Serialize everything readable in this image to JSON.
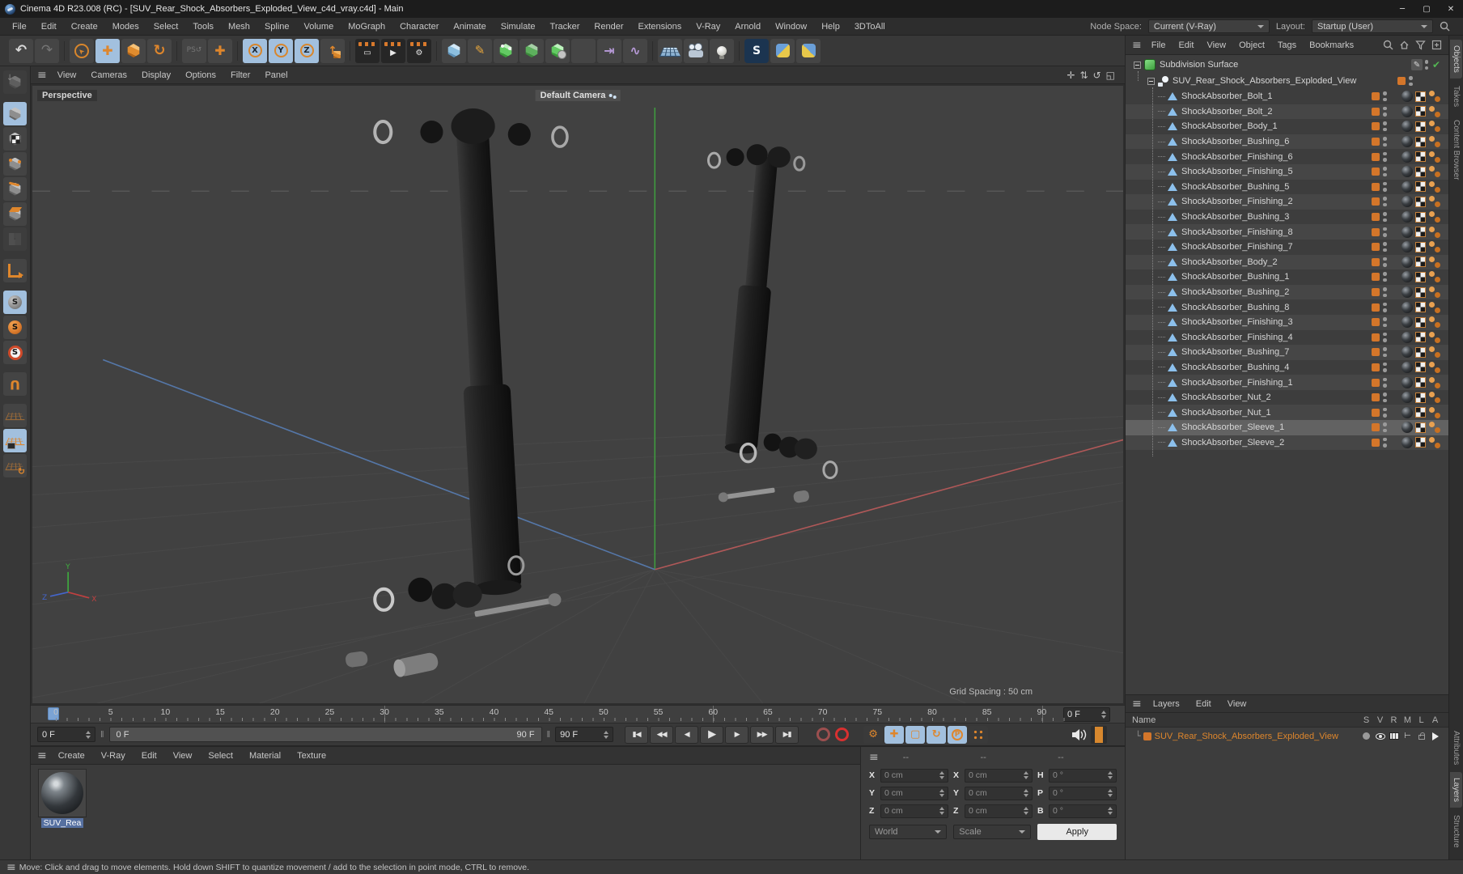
{
  "window": {
    "title": "Cinema 4D R23.008 (RC) - [SUV_Rear_Shock_Absorbers_Exploded_View_c4d_vray.c4d] - Main",
    "minimize": "─",
    "maximize": "▢",
    "close": "✕"
  },
  "menubar": {
    "items": [
      "File",
      "Edit",
      "Create",
      "Modes",
      "Select",
      "Tools",
      "Mesh",
      "Spline",
      "Volume",
      "MoGraph",
      "Character",
      "Animate",
      "Simulate",
      "Tracker",
      "Render",
      "Extensions",
      "V-Ray",
      "Arnold",
      "Window",
      "Help",
      "3DToAll"
    ],
    "node_space_label": "Node Space:",
    "node_space_value": "Current (V-Ray)",
    "layout_label": "Layout:",
    "layout_value": "Startup (User)"
  },
  "toolbar": {
    "tools": [
      {
        "name": "undo-button",
        "glyph": "↶",
        "cls": "t-undo"
      },
      {
        "name": "redo-button",
        "glyph": "↷",
        "cls": "t-dim"
      },
      {
        "name": "toolbar-separator",
        "glyph": "",
        "cls": "sep"
      },
      {
        "name": "live-selection-tool",
        "glyph": "➤",
        "cls": "t-sel-cursor"
      },
      {
        "name": "move-tool",
        "glyph": "✚",
        "cls": "t-orange active-blue"
      },
      {
        "name": "scale-tool",
        "glyph": "",
        "cls": "cube-orange"
      },
      {
        "name": "rotate-tool",
        "glyph": "↻",
        "cls": "t-orange t-big"
      },
      {
        "name": "toolbar-separator",
        "glyph": "",
        "cls": "sep"
      },
      {
        "name": "last-tool-psr",
        "glyph": "PS↺",
        "cls": "t-dim t-small"
      },
      {
        "name": "active-tool-move",
        "glyph": "✚",
        "cls": "t-orange"
      },
      {
        "name": "toolbar-separator",
        "glyph": "",
        "cls": "sep"
      },
      {
        "name": "lock-x-axis-button",
        "glyph": "X",
        "cls": "axis active-blue"
      },
      {
        "name": "lock-y-axis-button",
        "glyph": "Y",
        "cls": "axis active-blue"
      },
      {
        "name": "lock-z-axis-button",
        "glyph": "Z",
        "cls": "axis active-blue"
      },
      {
        "name": "coordinate-system-button",
        "glyph": "↑",
        "cls": "t-coord"
      },
      {
        "name": "toolbar-separator",
        "glyph": "",
        "cls": "sep"
      },
      {
        "name": "render-view-button",
        "glyph": "▭",
        "cls": "clapper"
      },
      {
        "name": "render-picture-viewer-button",
        "glyph": "▶",
        "cls": "clapper"
      },
      {
        "name": "render-settings-button",
        "glyph": "⚙",
        "cls": "clapper"
      },
      {
        "name": "toolbar-separator",
        "glyph": "",
        "cls": "sep"
      },
      {
        "name": "primitive-cube-button",
        "glyph": "",
        "cls": "cube-blue"
      },
      {
        "name": "spline-pen-button",
        "glyph": "✎",
        "cls": "t-pen"
      },
      {
        "name": "subdivision-surface-button",
        "glyph": "",
        "cls": "cube-green dots"
      },
      {
        "name": "generator-button",
        "glyph": "",
        "cls": "cube-green open"
      },
      {
        "name": "deformer-button",
        "glyph": "",
        "cls": "cube-green blob"
      },
      {
        "name": "volume-button",
        "glyph": "",
        "cls": "cubes-green"
      },
      {
        "name": "mograph-button",
        "glyph": "⇥",
        "cls": "t-purple"
      },
      {
        "name": "fields-button",
        "glyph": "∿",
        "cls": "t-purple"
      },
      {
        "name": "toolbar-separator",
        "glyph": "",
        "cls": "sep"
      },
      {
        "name": "floor-button",
        "glyph": "",
        "cls": "floor-grid"
      },
      {
        "name": "camera-button",
        "glyph": "",
        "cls": "cam"
      },
      {
        "name": "light-button",
        "glyph": "",
        "cls": "bulb"
      },
      {
        "name": "toolbar-separator",
        "glyph": "",
        "cls": "sep"
      },
      {
        "name": "vray-button",
        "glyph": "S",
        "cls": "vray"
      },
      {
        "name": "python-button",
        "glyph": "",
        "cls": "py"
      },
      {
        "name": "python-button-2",
        "glyph": "",
        "cls": "py py2"
      }
    ]
  },
  "left_toolbar": {
    "tools": [
      {
        "name": "make-editable-button",
        "glyph": "",
        "cls": "lc lc-dim arrow"
      },
      {
        "name": "left-separator",
        "glyph": "",
        "cls": "lsep"
      },
      {
        "name": "model-mode-button",
        "glyph": "",
        "cls": "lc active-blue"
      },
      {
        "name": "texture-mode-button",
        "glyph": "",
        "cls": "lc checker"
      },
      {
        "name": "point-mode-button",
        "glyph": "",
        "cls": "lc pts"
      },
      {
        "name": "edge-mode-button",
        "glyph": "",
        "cls": "lc edge"
      },
      {
        "name": "polygon-mode-button",
        "glyph": "",
        "cls": "lc face"
      },
      {
        "name": "uv-mode-button",
        "glyph": "",
        "cls": "flat lc-dim"
      },
      {
        "name": "left-separator",
        "glyph": "",
        "cls": "lsep"
      },
      {
        "name": "axis-mode-button",
        "glyph": "",
        "cls": "laxis"
      },
      {
        "name": "left-separator",
        "glyph": "",
        "cls": "lsep"
      },
      {
        "name": "viewport-solo-off-button",
        "glyph": "S",
        "cls": "scirc gray active-blue"
      },
      {
        "name": "viewport-solo-single-button",
        "glyph": "S",
        "cls": "scirc orange"
      },
      {
        "name": "viewport-solo-hierarchy-button",
        "glyph": "S",
        "cls": "scirc ring"
      },
      {
        "name": "left-separator",
        "glyph": "",
        "cls": "lsep"
      },
      {
        "name": "snap-button",
        "glyph": "U",
        "cls": "magnet"
      },
      {
        "name": "left-separator",
        "glyph": "",
        "cls": "lsep"
      },
      {
        "name": "workplane-button",
        "glyph": "",
        "cls": "wgrid dim"
      },
      {
        "name": "lock-workplane-button",
        "glyph": "",
        "cls": "wgrid lock active-blue"
      },
      {
        "name": "planar-workplane-button",
        "glyph": "",
        "cls": "wgrid dim rot"
      }
    ]
  },
  "viewport": {
    "menus": [
      "View",
      "Cameras",
      "Display",
      "Options",
      "Filter",
      "Panel"
    ],
    "nav_icons": [
      {
        "name": "pan-view-icon",
        "glyph": "✛"
      },
      {
        "name": "zoom-view-icon",
        "glyph": "⇅"
      },
      {
        "name": "rotate-view-icon",
        "glyph": "↺"
      },
      {
        "name": "toggle-view-icon",
        "glyph": "◱"
      }
    ],
    "view_label": "Perspective",
    "camera_label": "Default Camera",
    "grid_spacing": "Grid Spacing : 50 cm",
    "axis_x": "X",
    "axis_y": "Y",
    "axis_z": "Z"
  },
  "timeline": {
    "ticks": [
      "0",
      "5",
      "10",
      "15",
      "20",
      "25",
      "30",
      "35",
      "40",
      "45",
      "50",
      "55",
      "60",
      "65",
      "70",
      "75",
      "80",
      "85",
      "90"
    ],
    "current_frame": "0 F",
    "start_frame": "0 F",
    "range_start": "0 F",
    "range_end": "90 F",
    "end_frame": "90 F",
    "transport": [
      {
        "name": "goto-start-button",
        "glyph": "▮◀",
        "cls": ""
      },
      {
        "name": "previous-key-button",
        "glyph": "◀◀",
        "cls": "tgrp"
      },
      {
        "name": "previous-frame-button",
        "glyph": "◀",
        "cls": ""
      },
      {
        "name": "play-button",
        "glyph": "▶",
        "cls": "play"
      },
      {
        "name": "next-frame-button",
        "glyph": "▶",
        "cls": ""
      },
      {
        "name": "next-key-button",
        "glyph": "▶▶",
        "cls": ""
      },
      {
        "name": "goto-end-button",
        "glyph": "▶▮",
        "cls": "tend"
      }
    ],
    "key_buttons": [
      {
        "name": "autokeying-button",
        "glyph": "⚙",
        "cls": ""
      },
      {
        "name": "key-position-button",
        "glyph": "✚",
        "cls": "blue"
      },
      {
        "name": "key-scale-button",
        "glyph": "▢",
        "cls": "blue"
      },
      {
        "name": "key-rotation-button",
        "glyph": "↻",
        "cls": "blue"
      },
      {
        "name": "key-parameter-button",
        "glyph": "P",
        "cls": "blue pcirc"
      },
      {
        "name": "key-pla-button",
        "glyph": "",
        "cls": "pla"
      }
    ]
  },
  "materials": {
    "menus": [
      "Create",
      "V-Ray",
      "Edit",
      "View",
      "Select",
      "Material",
      "Texture"
    ],
    "items": [
      {
        "name": "SUV_Rea"
      }
    ]
  },
  "coordinates": {
    "headers": [
      "--",
      "--",
      "--"
    ],
    "fields": [
      {
        "label": "X",
        "value": "0 cm"
      },
      {
        "label": "Y",
        "value": "0 cm"
      },
      {
        "label": "Z",
        "value": "0 cm"
      },
      {
        "label": "X",
        "value": "0 cm"
      },
      {
        "label": "Y",
        "value": "0 cm"
      },
      {
        "label": "Z",
        "value": "0 cm"
      },
      {
        "label": "H",
        "value": "0 °"
      },
      {
        "label": "P",
        "value": "0 °"
      },
      {
        "label": "B",
        "value": "0 °"
      }
    ],
    "mode_dropdown": "World",
    "scale_dropdown": "Scale",
    "apply_label": "Apply"
  },
  "object_manager": {
    "menus": [
      "File",
      "Edit",
      "View",
      "Object",
      "Tags",
      "Bookmarks"
    ],
    "root_name": "Subdivision Surface",
    "parent_name": "SUV_Rear_Shock_Absorbers_Exploded_View",
    "children": [
      {
        "name": "ShockAbsorber_Bolt_1",
        "cls": ""
      },
      {
        "name": "ShockAbsorber_Bolt_2",
        "cls": ""
      },
      {
        "name": "ShockAbsorber_Body_1",
        "cls": ""
      },
      {
        "name": "ShockAbsorber_Bushing_6",
        "cls": ""
      },
      {
        "name": "ShockAbsorber_Finishing_6",
        "cls": ""
      },
      {
        "name": "ShockAbsorber_Finishing_5",
        "cls": ""
      },
      {
        "name": "ShockAbsorber_Bushing_5",
        "cls": ""
      },
      {
        "name": "ShockAbsorber_Finishing_2",
        "cls": ""
      },
      {
        "name": "ShockAbsorber_Bushing_3",
        "cls": ""
      },
      {
        "name": "ShockAbsorber_Finishing_8",
        "cls": ""
      },
      {
        "name": "ShockAbsorber_Finishing_7",
        "cls": ""
      },
      {
        "name": "ShockAbsorber_Body_2",
        "cls": ""
      },
      {
        "name": "ShockAbsorber_Bushing_1",
        "cls": ""
      },
      {
        "name": "ShockAbsorber_Bushing_2",
        "cls": ""
      },
      {
        "name": "ShockAbsorber_Bushing_8",
        "cls": ""
      },
      {
        "name": "ShockAbsorber_Finishing_3",
        "cls": ""
      },
      {
        "name": "ShockAbsorber_Finishing_4",
        "cls": ""
      },
      {
        "name": "ShockAbsorber_Bushing_7",
        "cls": ""
      },
      {
        "name": "ShockAbsorber_Bushing_4",
        "cls": ""
      },
      {
        "name": "ShockAbsorber_Finishing_1",
        "cls": ""
      },
      {
        "name": "ShockAbsorber_Nut_2",
        "cls": ""
      },
      {
        "name": "ShockAbsorber_Nut_1",
        "cls": ""
      },
      {
        "name": "ShockAbsorber_Sleeve_1",
        "cls": "selected"
      },
      {
        "name": "ShockAbsorber_Sleeve_2",
        "cls": ""
      }
    ]
  },
  "layers_panel": {
    "menus": [
      "Layers",
      "Edit",
      "View"
    ],
    "name_header": "Name",
    "columns": [
      "S",
      "V",
      "R",
      "M",
      "L",
      "A"
    ],
    "layer_name": "SUV_Rear_Shock_Absorbers_Exploded_View"
  },
  "right_tabs": {
    "top": [
      {
        "label": "Objects",
        "cls": "on"
      },
      {
        "label": "Takes",
        "cls": ""
      },
      {
        "label": "Content Browser",
        "cls": ""
      }
    ],
    "bottom": [
      {
        "label": "Attributes",
        "cls": ""
      },
      {
        "label": "Layers",
        "cls": "on"
      },
      {
        "label": "Structure",
        "cls": ""
      }
    ]
  },
  "statusbar": {
    "text": "Move: Click and drag to move elements. Hold down SHIFT to quantize movement / add to the selection in point mode, CTRL to remove."
  }
}
